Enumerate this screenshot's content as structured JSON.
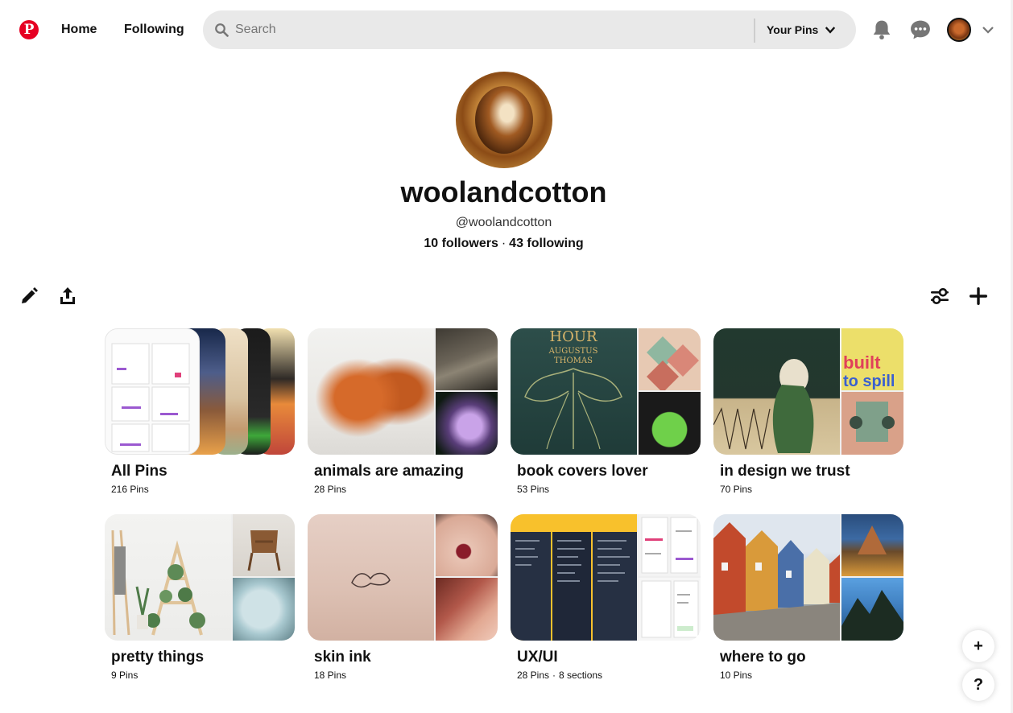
{
  "header": {
    "logo": "P",
    "nav": {
      "home": "Home",
      "following": "Following"
    },
    "search": {
      "placeholder": "Search",
      "scope_label": "Your Pins"
    }
  },
  "profile": {
    "name": "woolandcotton",
    "handle": "@woolandcotton",
    "followers": "10 followers",
    "following": "43 following",
    "separator": "·"
  },
  "boards": [
    {
      "title": "All Pins",
      "pins": "216 Pins"
    },
    {
      "title": "animals are amazing",
      "pins": "28 Pins"
    },
    {
      "title": "book covers lover",
      "pins": "53 Pins"
    },
    {
      "title": "in design we trust",
      "pins": "70 Pins"
    },
    {
      "title": "pretty things",
      "pins": "9 Pins"
    },
    {
      "title": "skin ink",
      "pins": "18 Pins"
    },
    {
      "title": "UX/UI",
      "pins": "28 Pins",
      "sections": "8 sections"
    },
    {
      "title": "where to go",
      "pins": "10 Pins"
    }
  ],
  "cover_art": {
    "book_cover": {
      "line1": "HOUR",
      "line2": "AUGUSTUS",
      "line3": "THOMAS"
    },
    "poster": {
      "line1": "built",
      "line2": "to spill"
    }
  },
  "fab": {
    "add": "+",
    "help": "?"
  },
  "colors": {
    "brand": "#e60023",
    "search_bg": "#e9e9e9",
    "text": "#111111"
  },
  "icons": [
    "pinterest-logo",
    "search-icon",
    "chevron-down-icon",
    "bell-icon",
    "chat-icon",
    "pencil-icon",
    "share-icon",
    "filter-icon",
    "plus-icon"
  ]
}
